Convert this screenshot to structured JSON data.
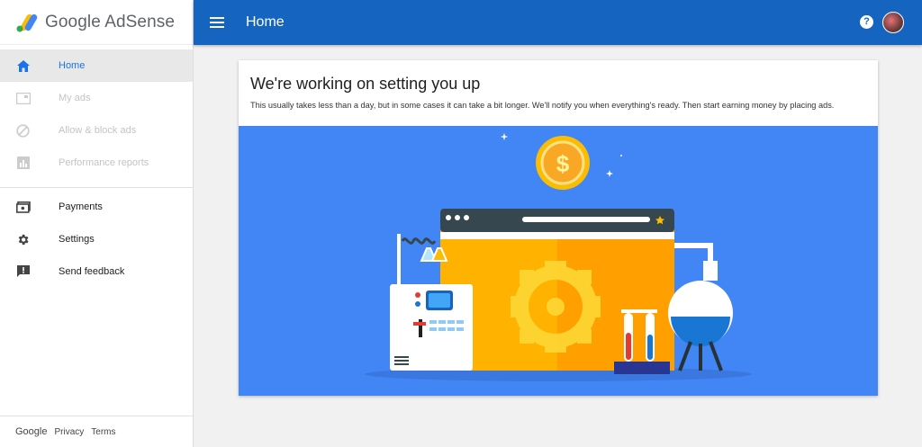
{
  "app": {
    "title": "Google AdSense"
  },
  "header": {
    "title": "Home"
  },
  "sidebar": {
    "items": [
      {
        "label": "Home",
        "icon": "home-icon",
        "state": "active"
      },
      {
        "label": "My ads",
        "icon": "ads-icon",
        "state": "disabled"
      },
      {
        "label": "Allow & block ads",
        "icon": "block-icon",
        "state": "disabled"
      },
      {
        "label": "Performance reports",
        "icon": "chart-icon",
        "state": "disabled"
      },
      {
        "label": "Payments",
        "icon": "payments-icon",
        "state": "normal"
      },
      {
        "label": "Settings",
        "icon": "gear-icon",
        "state": "normal"
      },
      {
        "label": "Send feedback",
        "icon": "feedback-icon",
        "state": "normal"
      }
    ]
  },
  "footer": {
    "google": "Google",
    "privacy": "Privacy",
    "terms": "Terms"
  },
  "card": {
    "title": "We're working on setting you up",
    "subtitle": "This usually takes less than a day, but in some cases it can take a bit longer. We'll notify you when everything's ready. Then start earning money by placing ads."
  },
  "colors": {
    "header": "#1565c0",
    "accent": "#1a73e8",
    "illustration_bg": "#4285f4"
  }
}
